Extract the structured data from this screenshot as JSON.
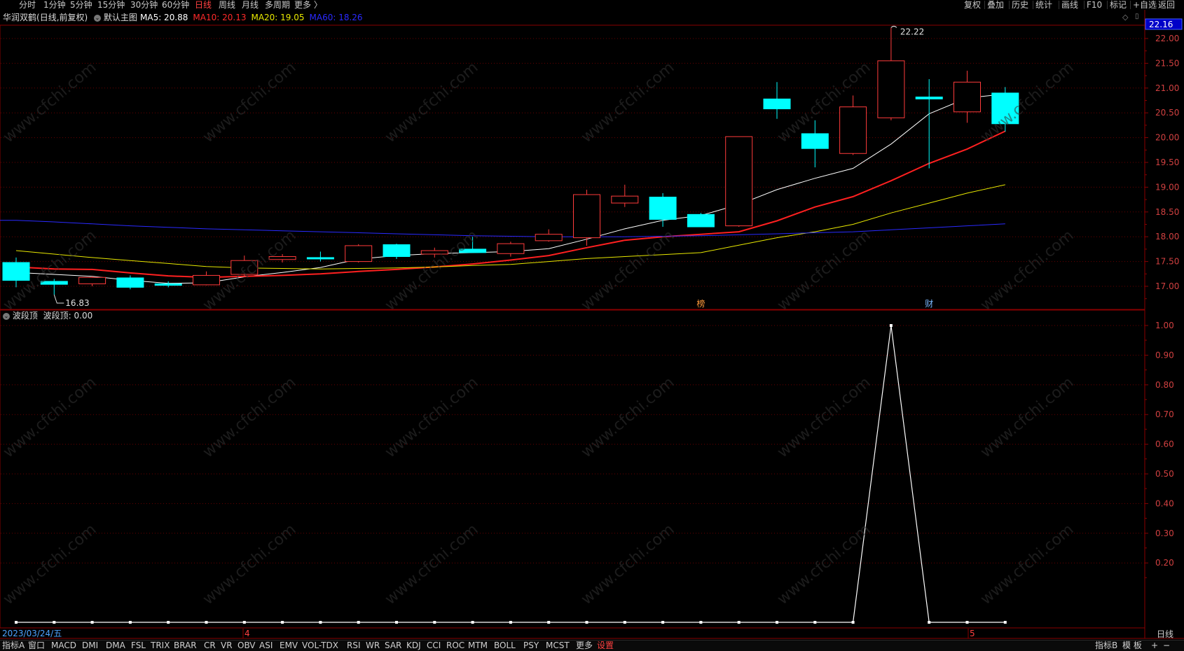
{
  "top_nav": {
    "periods": [
      "分时",
      "1分钟",
      "5分钟",
      "15分钟",
      "30分钟",
      "60分钟",
      "日线",
      "周线",
      "月线",
      "多周期",
      "更多 〉"
    ],
    "active_period": "日线",
    "tools": [
      "复权",
      "叠加",
      "历史",
      "统计",
      "画线",
      "F10",
      "标记",
      "+自选",
      "返回"
    ]
  },
  "main_chart": {
    "stock_name": "华润双鹤",
    "mode": "(日线,前复权)",
    "template": "默认主图",
    "ma": [
      {
        "label": "MA5: 20.88",
        "color": "#ffffff"
      },
      {
        "label": "MA10: 20.13",
        "color": "#ff2a2a"
      },
      {
        "label": "MA20: 19.05",
        "color": "#e8e800"
      },
      {
        "label": "MA60: 18.26",
        "color": "#2a2aff"
      }
    ],
    "price_box": "22.16",
    "high_label": "22.22",
    "low_label": "16.83",
    "event_labels": [
      {
        "text": "榜",
        "color": "#ff9a3c"
      },
      {
        "text": "财",
        "color": "#7ab8ff"
      }
    ]
  },
  "indicator": {
    "name": "波段顶",
    "value_label": "波段顶: 0.00"
  },
  "date_axis": {
    "first_date": "2023/03/24/五",
    "month_marks": [
      "4",
      "5"
    ]
  },
  "bottom_tabs": {
    "items": [
      "指标A",
      "窗口",
      "MACD",
      "DMI",
      "DMA",
      "FSL",
      "TRIX",
      "BRAR",
      "CR",
      "VR",
      "OBV",
      "ASI",
      "EMV",
      "VOL-TDX",
      "RSI",
      "WR",
      "SAR",
      "KDJ",
      "CCI",
      "ROC",
      "MTM",
      "BOLL",
      "PSY",
      "MCST",
      "更多",
      "设置"
    ],
    "active": "设置",
    "right_items": [
      "指标B",
      "模 板",
      "日线",
      "+",
      "−"
    ]
  },
  "watermark_text": "www.cfchi.com",
  "chart_data": [
    {
      "type": "candlestick",
      "title": "华润双鹤 (日线,前复权)",
      "ylim": [
        16.6,
        22.3
      ],
      "y_ticks": [
        17.0,
        17.5,
        18.0,
        18.5,
        19.0,
        19.5,
        20.0,
        20.5,
        21.0,
        21.5,
        22.0
      ],
      "candles": [
        {
          "o": 17.48,
          "h": 17.58,
          "l": 16.98,
          "c": 17.12
        },
        {
          "o": 17.1,
          "h": 17.15,
          "l": 16.83,
          "c": 17.04
        },
        {
          "o": 17.05,
          "h": 17.2,
          "l": 17.0,
          "c": 17.18
        },
        {
          "o": 17.17,
          "h": 17.22,
          "l": 16.94,
          "c": 16.98
        },
        {
          "o": 17.05,
          "h": 17.1,
          "l": 16.98,
          "c": 17.02
        },
        {
          "o": 17.03,
          "h": 17.3,
          "l": 17.02,
          "c": 17.22
        },
        {
          "o": 17.24,
          "h": 17.62,
          "l": 17.2,
          "c": 17.52
        },
        {
          "o": 17.54,
          "h": 17.65,
          "l": 17.48,
          "c": 17.6
        },
        {
          "o": 17.58,
          "h": 17.7,
          "l": 17.5,
          "c": 17.57
        },
        {
          "o": 17.5,
          "h": 17.85,
          "l": 17.48,
          "c": 17.82
        },
        {
          "o": 17.84,
          "h": 17.86,
          "l": 17.55,
          "c": 17.6
        },
        {
          "o": 17.65,
          "h": 17.78,
          "l": 17.58,
          "c": 17.72
        },
        {
          "o": 17.75,
          "h": 18.0,
          "l": 17.68,
          "c": 17.68
        },
        {
          "o": 17.66,
          "h": 17.9,
          "l": 17.6,
          "c": 17.86
        },
        {
          "o": 17.92,
          "h": 18.15,
          "l": 17.9,
          "c": 18.05
        },
        {
          "o": 17.98,
          "h": 18.95,
          "l": 17.82,
          "c": 18.85
        },
        {
          "o": 18.68,
          "h": 19.05,
          "l": 18.6,
          "c": 18.82
        },
        {
          "o": 18.8,
          "h": 18.88,
          "l": 18.2,
          "c": 18.35
        },
        {
          "o": 18.45,
          "h": 18.48,
          "l": 18.2,
          "c": 18.2
        },
        {
          "o": 18.22,
          "h": 20.02,
          "l": 18.2,
          "c": 20.02
        },
        {
          "o": 20.78,
          "h": 21.12,
          "l": 20.38,
          "c": 20.58
        },
        {
          "o": 20.08,
          "h": 20.35,
          "l": 19.4,
          "c": 19.78
        },
        {
          "o": 19.68,
          "h": 20.85,
          "l": 19.65,
          "c": 20.62
        },
        {
          "o": 20.4,
          "h": 22.22,
          "l": 20.35,
          "c": 21.55
        },
        {
          "o": 20.82,
          "h": 21.18,
          "l": 19.38,
          "c": 20.78
        },
        {
          "o": 20.52,
          "h": 21.35,
          "l": 20.3,
          "c": 21.12
        },
        {
          "o": 20.9,
          "h": 21.02,
          "l": 20.12,
          "c": 20.28
        }
      ],
      "ma_series": [
        {
          "name": "MA5",
          "values": [
            17.28,
            17.24,
            17.2,
            17.12,
            17.06,
            17.07,
            17.19,
            17.28,
            17.38,
            17.55,
            17.62,
            17.66,
            17.68,
            17.7,
            17.76,
            17.95,
            18.16,
            18.33,
            18.43,
            18.65,
            18.95,
            19.18,
            19.38,
            19.87,
            20.48,
            20.8,
            20.88
          ]
        },
        {
          "name": "MA10",
          "values": [
            17.39,
            17.35,
            17.34,
            17.27,
            17.21,
            17.18,
            17.2,
            17.22,
            17.25,
            17.3,
            17.34,
            17.39,
            17.45,
            17.53,
            17.62,
            17.78,
            17.93,
            18.0,
            18.05,
            18.1,
            18.32,
            18.6,
            18.81,
            19.13,
            19.48,
            19.77,
            20.13
          ]
        },
        {
          "name": "MA20",
          "values": [
            17.72,
            17.65,
            17.58,
            17.52,
            17.46,
            17.4,
            17.37,
            17.36,
            17.35,
            17.36,
            17.37,
            17.39,
            17.42,
            17.44,
            17.5,
            17.56,
            17.6,
            17.64,
            17.68,
            17.83,
            17.98,
            18.1,
            18.25,
            18.48,
            18.68,
            18.88,
            19.05
          ]
        },
        {
          "name": "MA60",
          "values": [
            18.33,
            18.3,
            18.26,
            18.22,
            18.19,
            18.16,
            18.14,
            18.12,
            18.1,
            18.08,
            18.06,
            18.04,
            18.02,
            18.01,
            18.0,
            18.0,
            18.0,
            18.01,
            18.02,
            18.04,
            18.06,
            18.08,
            18.1,
            18.14,
            18.18,
            18.22,
            18.26
          ]
        }
      ]
    },
    {
      "type": "line",
      "title": "波段顶",
      "ylim": [
        0.0,
        1.05
      ],
      "y_ticks": [
        0.2,
        0.3,
        0.4,
        0.5,
        0.6,
        0.7,
        0.8,
        0.9,
        1.0
      ],
      "values": [
        0,
        0,
        0,
        0,
        0,
        0,
        0,
        0,
        0,
        0,
        0,
        0,
        0,
        0,
        0,
        0,
        0,
        0,
        0,
        0,
        0,
        0,
        0,
        1,
        0,
        0,
        0
      ]
    }
  ]
}
